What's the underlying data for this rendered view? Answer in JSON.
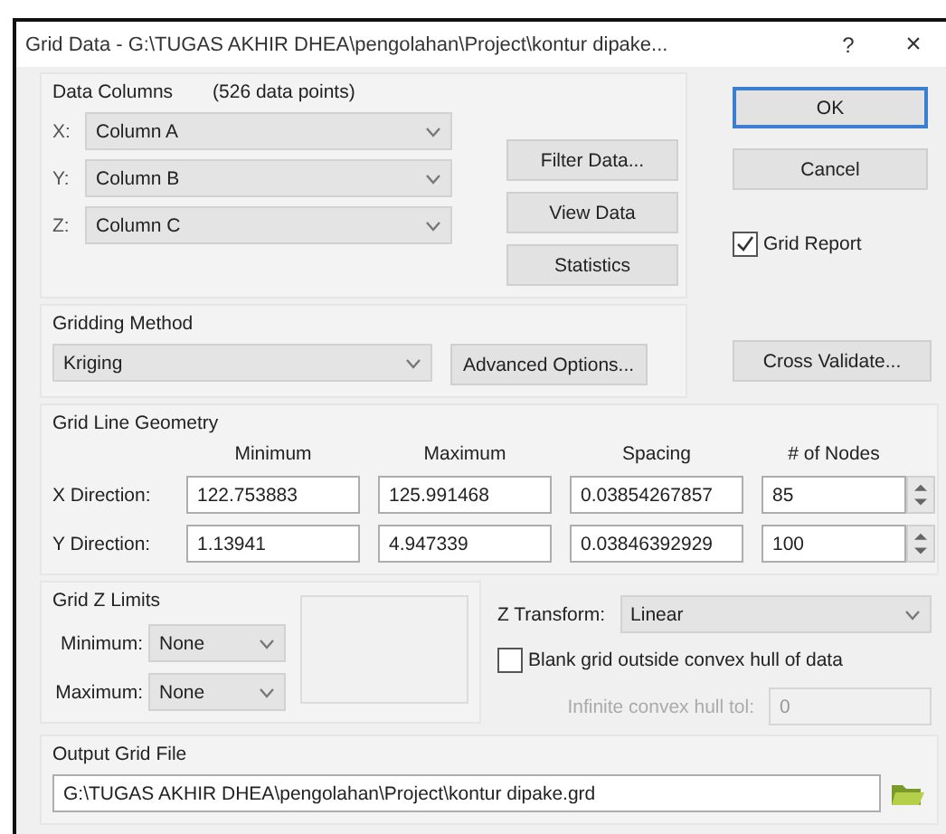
{
  "window": {
    "title": "Grid Data - G:\\TUGAS AKHIR DHEA\\pengolahan\\Project\\kontur dipake...",
    "help": "?",
    "close": "×"
  },
  "data_columns": {
    "label": "Data Columns",
    "count": "(526 data points)",
    "rows": [
      {
        "label": "X:",
        "value": "Column A"
      },
      {
        "label": "Y:",
        "value": "Column B"
      },
      {
        "label": "Z:",
        "value": "Column C"
      }
    ],
    "buttons": [
      "Filter Data...",
      "View Data",
      "Statistics"
    ]
  },
  "dialog_buttons": [
    {
      "label": "OK",
      "default": true
    },
    {
      "label": "Cancel",
      "default": false
    }
  ],
  "grid_report": {
    "label": "Grid Report",
    "checked": true
  },
  "gridding_method": {
    "label": "Gridding Method",
    "value": "Kriging",
    "button": "Advanced Options..."
  },
  "cross_validate": "Cross Validate...",
  "grid_line_geometry": {
    "label": "Grid Line Geometry",
    "columns": [
      "Minimum",
      "Maximum",
      "Spacing",
      "# of Nodes"
    ],
    "rows": [
      {
        "label": "X Direction:",
        "minimum": "122.753883",
        "maximum": "125.991468",
        "spacing": "0.03854267857",
        "nodes": "85"
      },
      {
        "label": "Y Direction:",
        "minimum": "1.13941",
        "maximum": "4.947339",
        "spacing": "0.03846392929",
        "nodes": "100"
      }
    ]
  },
  "grid_z_limits": {
    "label": "Grid Z Limits",
    "rows": [
      {
        "label": "Minimum:",
        "value": "None"
      },
      {
        "label": "Maximum:",
        "value": "None"
      }
    ]
  },
  "z_transform": {
    "label": "Z Transform:",
    "value": "Linear"
  },
  "blank_outside_hull": {
    "label": "Blank grid outside convex hull of data",
    "checked": false
  },
  "hull_tolerance": {
    "label": "Infinite convex hull tol:",
    "value": "0",
    "disabled": true
  },
  "output_grid_file": {
    "label": "Output Grid File",
    "value": "G:\\TUGAS AKHIR DHEA\\pengolahan\\Project\\kontur dipake.grd"
  }
}
